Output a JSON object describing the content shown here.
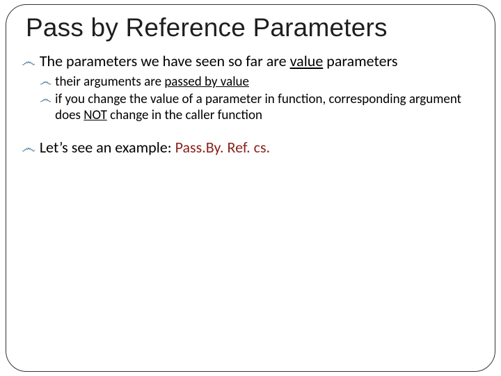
{
  "title": "Pass by Reference Parameters",
  "bullets": {
    "b1_pre": "The parameters we have seen so far are ",
    "b1_u": "value",
    "b1_post": " parameters",
    "b1a_pre": "their arguments are ",
    "b1a_u": "passed by value",
    "b1b_pre": "if you change the value of a parameter in function, corresponding argument does ",
    "b1b_u": "NOT",
    "b1b_post": " change in the caller function",
    "b2_pre": "Let’s see an example: ",
    "b2_file": "Pass.By. Ref. cs."
  },
  "glyph": "෴"
}
